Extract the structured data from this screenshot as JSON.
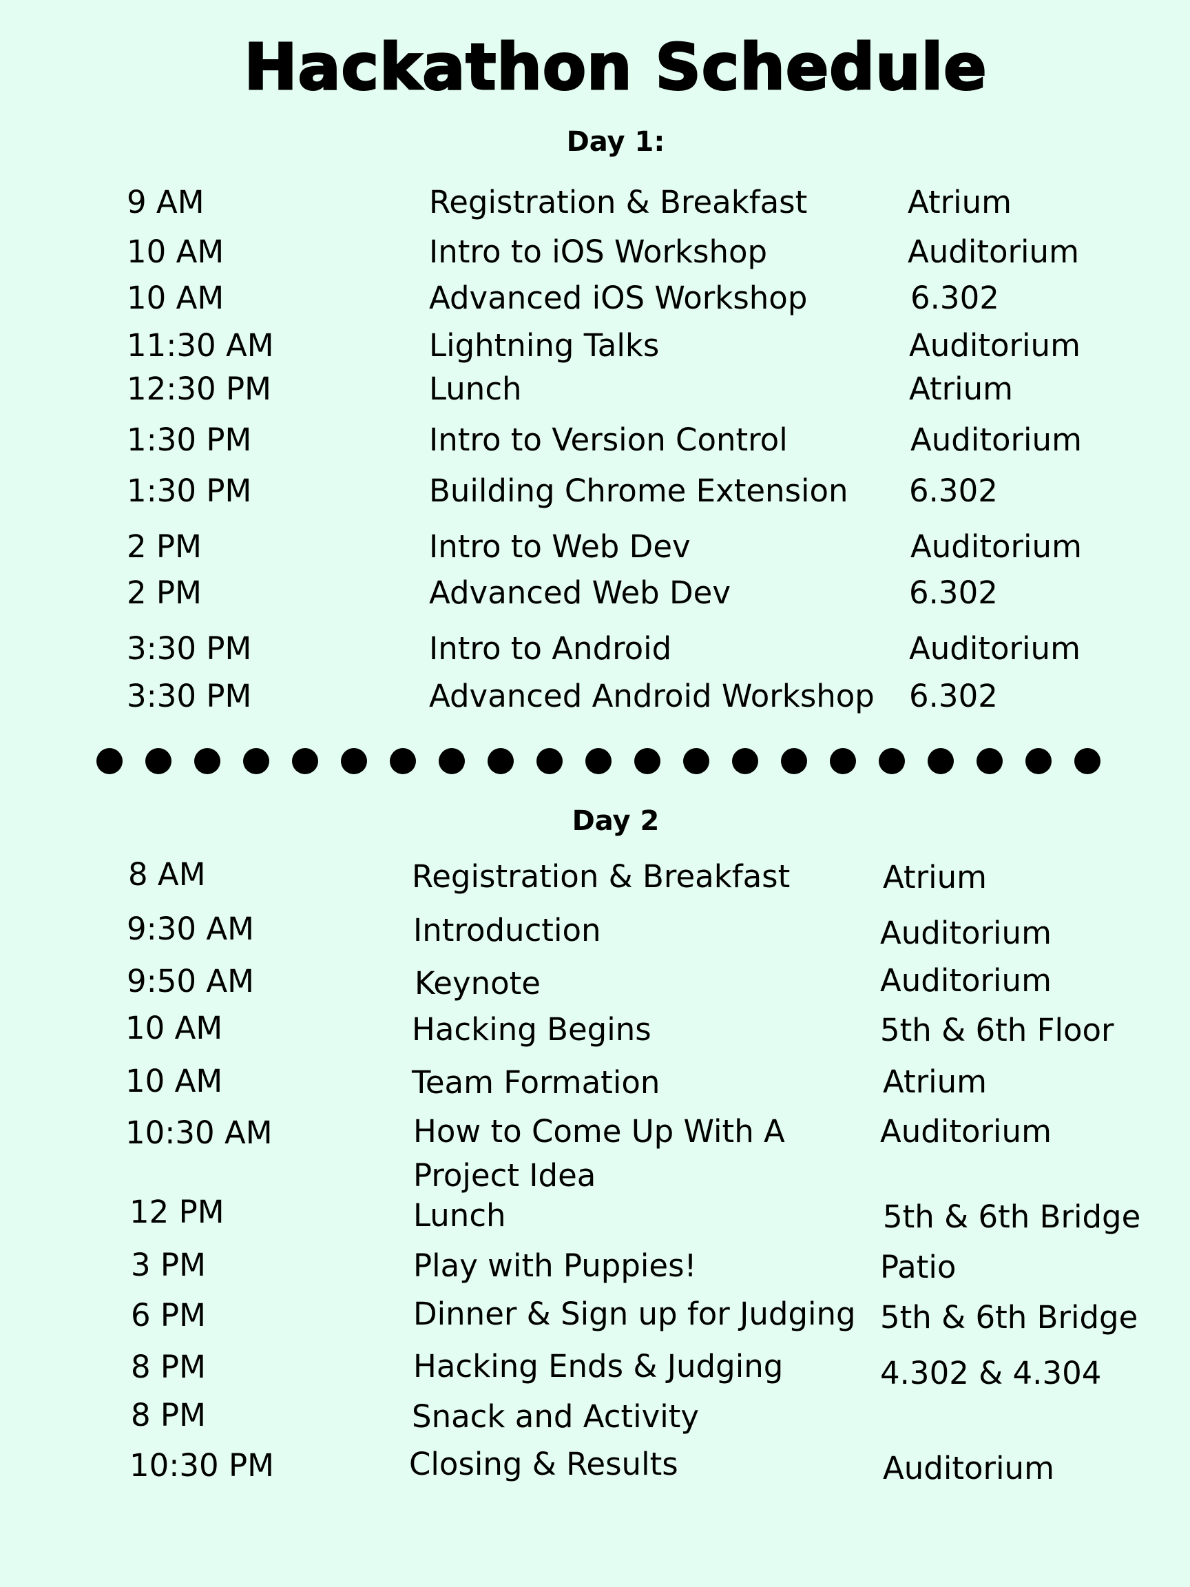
{
  "title": "Hackathon Schedule",
  "day1": {
    "heading": "Day 1:",
    "events": [
      {
        "time": "9 AM",
        "event": "Registration & Breakfast",
        "location": "Atrium"
      },
      {
        "time": "10 AM",
        "event": "Intro to iOS Workshop",
        "location": "Auditorium"
      },
      {
        "time": "10 AM",
        "event": "Advanced iOS Workshop",
        "location": "6.302"
      },
      {
        "time": "11:30 AM",
        "event": "Lightning Talks",
        "location": "Auditorium"
      },
      {
        "time": "12:30 PM",
        "event": "Lunch",
        "location": "Atrium"
      },
      {
        "time": "1:30 PM",
        "event": "Intro to Version Control",
        "location": "Auditorium"
      },
      {
        "time": "1:30 PM",
        "event": "Building Chrome Extension",
        "location": "6.302"
      },
      {
        "time": "2 PM",
        "event": "Intro to Web Dev",
        "location": "Auditorium"
      },
      {
        "time": "2 PM",
        "event": "Advanced Web Dev",
        "location": "6.302"
      },
      {
        "time": "3:30 PM",
        "event": "Intro to Android",
        "location": "Auditorium"
      },
      {
        "time": "3:30 PM",
        "event": "Advanced Android Workshop",
        "location": "6.302"
      }
    ]
  },
  "day2": {
    "heading": "Day 2",
    "events": [
      {
        "time": "8 AM",
        "event": "Registration & Breakfast",
        "location": "Atrium"
      },
      {
        "time": "9:30 AM",
        "event": "Introduction",
        "location": "Auditorium"
      },
      {
        "time": "9:50 AM",
        "event": "Keynote",
        "location": "Auditorium"
      },
      {
        "time": "10 AM",
        "event": "Hacking Begins",
        "location": "5th & 6th Floor"
      },
      {
        "time": "10 AM",
        "event": "Team Formation",
        "location": "Atrium"
      },
      {
        "time": "10:30 AM",
        "event": "How to Come Up With A Project Idea",
        "location": "Auditorium"
      },
      {
        "time": "12 PM",
        "event": "Lunch",
        "location": "5th & 6th Bridge"
      },
      {
        "time": "3 PM",
        "event": "Play with Puppies!",
        "location": "Patio"
      },
      {
        "time": "6 PM",
        "event": "Dinner & Sign up for Judging",
        "location": "5th & 6th Bridge"
      },
      {
        "time": "8 PM",
        "event": "Hacking Ends & Judging",
        "location": "4.302 & 4.304"
      },
      {
        "time": "8 PM",
        "event": "Snack and Activity",
        "location": ""
      },
      {
        "time": "10:30 PM",
        "event": "Closing & Results",
        "location": "Auditorium"
      }
    ]
  },
  "separator_dot_count": 21
}
